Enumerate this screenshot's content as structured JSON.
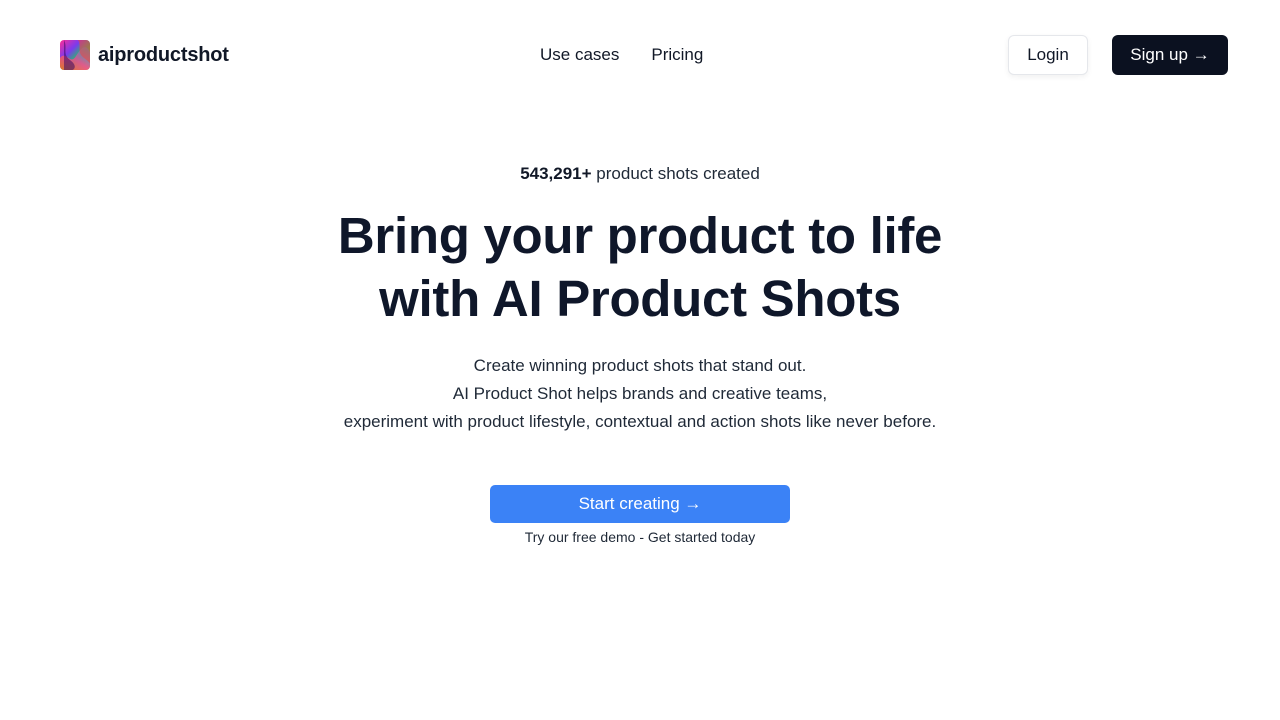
{
  "header": {
    "logo_text": "aiproductshot",
    "nav": [
      {
        "label": "Use cases"
      },
      {
        "label": "Pricing"
      }
    ],
    "login_label": "Login",
    "signup_label": "Sign up →"
  },
  "hero": {
    "stat_number": "543,291+",
    "stat_text": " product shots created",
    "headline_line1": "Bring your product to life",
    "headline_line2": "with AI Product Shots",
    "subtext": [
      "Create winning product shots that stand out.",
      "AI Product Shot helps brands and creative teams,",
      "experiment with product lifestyle, contextual and action shots like never before."
    ],
    "cta_label": "Start creating →",
    "cta_note": "Try our free demo - Get started today"
  },
  "colors": {
    "accent": "#3b82f6",
    "dark": "#0b1120",
    "text": "#111827"
  },
  "icons": {
    "logo": "colorful-abstract-logo-icon"
  }
}
